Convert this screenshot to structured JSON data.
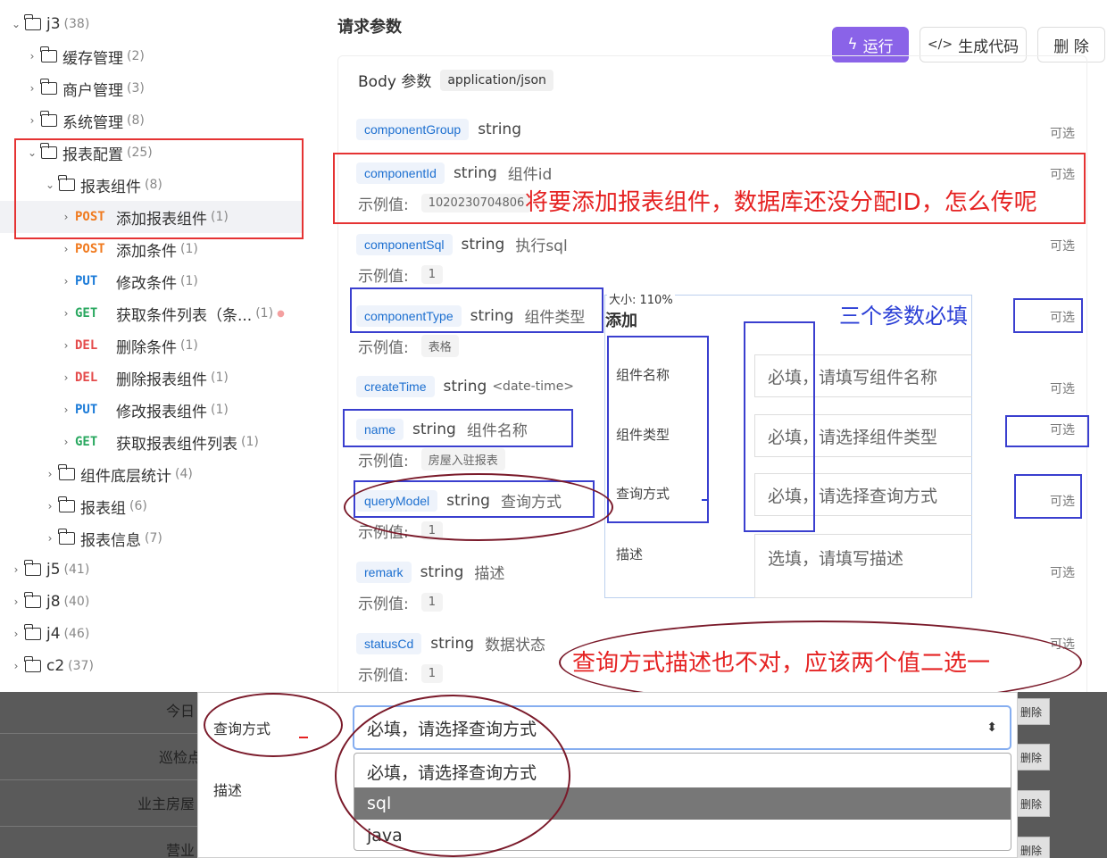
{
  "tree": {
    "items": [
      {
        "label": "j3",
        "count": "(38)"
      },
      {
        "label": "缓存管理",
        "count": "(2)"
      },
      {
        "label": "商户管理",
        "count": "(3)"
      },
      {
        "label": "系统管理",
        "count": "(8)"
      },
      {
        "label": "报表配置",
        "count": "(25)"
      },
      {
        "label": "报表组件",
        "count": "(8)"
      },
      {
        "method": "POST",
        "label": "添加报表组件",
        "count": "(1)"
      },
      {
        "method": "POST",
        "label": "添加条件",
        "count": "(1)"
      },
      {
        "method": "PUT",
        "label": "修改条件",
        "count": "(1)"
      },
      {
        "method": "GET",
        "label": "获取条件列表（条...",
        "count": "(1)"
      },
      {
        "method": "DEL",
        "label": "删除条件",
        "count": "(1)"
      },
      {
        "method": "DEL",
        "label": "删除报表组件",
        "count": "(1)"
      },
      {
        "method": "PUT",
        "label": "修改报表组件",
        "count": "(1)"
      },
      {
        "method": "GET",
        "label": "获取报表组件列表",
        "count": "(1)"
      },
      {
        "label": "组件底层统计",
        "count": "(4)"
      },
      {
        "label": "报表组",
        "count": "(6)"
      },
      {
        "label": "报表信息",
        "count": "(7)"
      },
      {
        "label": "j5",
        "count": "(41)"
      },
      {
        "label": "j8",
        "count": "(40)"
      },
      {
        "label": "j4",
        "count": "(46)"
      },
      {
        "label": "c2",
        "count": "(37)"
      }
    ]
  },
  "main": {
    "section_title": "请求参数",
    "run_label": "运行",
    "gen_label": "生成代码",
    "del_label": "删 除",
    "body_label": "Body 参数",
    "content_type": "application/json",
    "example_label": "示例值:",
    "optional": "可选",
    "params": [
      {
        "name": "componentGroup",
        "type": "string",
        "desc": "",
        "example": ""
      },
      {
        "name": "componentId",
        "type": "string",
        "desc": "组件id",
        "example": "1020230704806"
      },
      {
        "name": "componentSql",
        "type": "string",
        "desc": "执行sql",
        "example": "1"
      },
      {
        "name": "componentType",
        "type": "string",
        "desc": "组件类型",
        "example": "表格"
      },
      {
        "name": "createTime",
        "type": "string",
        "desc": "<date-time>",
        "example": ""
      },
      {
        "name": "name",
        "type": "string",
        "desc": "组件名称",
        "example": "房屋入驻报表"
      },
      {
        "name": "queryModel",
        "type": "string",
        "desc": "查询方式",
        "example": "1"
      },
      {
        "name": "remark",
        "type": "string",
        "desc": "描述",
        "example": "1"
      },
      {
        "name": "statusCd",
        "type": "string",
        "desc": "数据状态",
        "example": "1"
      }
    ]
  },
  "annotations": {
    "id_question": "将要添加报表组件，数据库还没分配ID，怎么传呢",
    "required_three": "三个参数必填",
    "query_wrong": "查询方式描述也不对，应该两个值二选一"
  },
  "popup": {
    "zoom": "大小: 110%",
    "title": "添加",
    "fields": [
      {
        "label": "组件名称",
        "placeholder": "必填，请填写组件名称"
      },
      {
        "label": "组件类型",
        "placeholder": "必填，请选择组件类型"
      },
      {
        "label": "查询方式",
        "placeholder": "必填，请选择查询方式"
      },
      {
        "label": "描述",
        "placeholder": "选填，请填写描述"
      }
    ]
  },
  "bottom": {
    "row_labels": [
      "今日",
      "巡检点",
      "业主房屋",
      "营业"
    ],
    "delete_label": "删除",
    "form": {
      "query_label": "查询方式",
      "desc_label": "描述",
      "select_value": "必填，请选择查询方式",
      "options": [
        "必填，请选择查询方式",
        "sql",
        "java"
      ]
    }
  }
}
